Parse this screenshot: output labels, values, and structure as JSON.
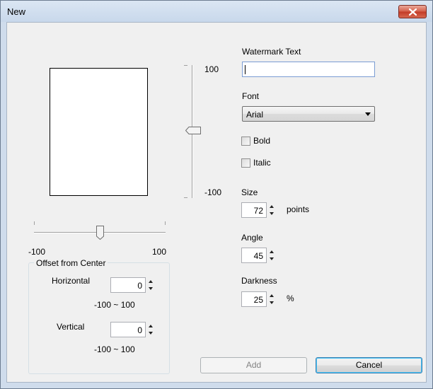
{
  "window": {
    "title": "New"
  },
  "vertical_slider": {
    "max_label": "100",
    "min_label": "-100"
  },
  "horizontal_slider": {
    "min_label": "-100",
    "max_label": "100"
  },
  "offset": {
    "group_title": "Offset from Center",
    "horizontal_label": "Horizontal",
    "horizontal_value": "0",
    "horizontal_range": "-100 ~ 100",
    "vertical_label": "Vertical",
    "vertical_value": "0",
    "vertical_range": "-100 ~ 100"
  },
  "watermark": {
    "label": "Watermark Text",
    "value": ""
  },
  "font": {
    "label": "Font",
    "value": "Arial",
    "bold_label": "Bold",
    "bold_checked": false,
    "italic_label": "Italic",
    "italic_checked": false
  },
  "size": {
    "label": "Size",
    "value": "72",
    "unit": "points"
  },
  "angle": {
    "label": "Angle",
    "value": "45"
  },
  "darkness": {
    "label": "Darkness",
    "value": "25",
    "unit": "%"
  },
  "buttons": {
    "add": "Add",
    "cancel": "Cancel"
  },
  "colors": {
    "title_bar": "#c8d8eb",
    "close_button": "#c23a26",
    "dialog_bg": "#f0f0f0",
    "input_focus_border": "#7a9cd3",
    "default_button_border": "#3c7fb1"
  }
}
